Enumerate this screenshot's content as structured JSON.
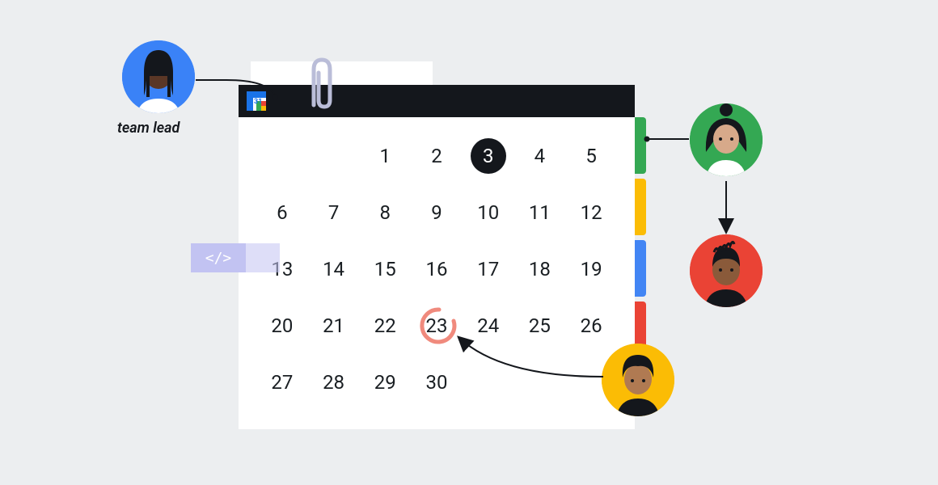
{
  "labels": {
    "team_lead": "team lead"
  },
  "calendar": {
    "icon_day": "31",
    "selected_day": 3,
    "circled_day": 23,
    "days": [
      null,
      null,
      1,
      2,
      3,
      4,
      5,
      6,
      7,
      8,
      9,
      10,
      11,
      12,
      13,
      14,
      15,
      16,
      17,
      18,
      19,
      20,
      21,
      22,
      23,
      24,
      25,
      26,
      27,
      28,
      29,
      30,
      null,
      null,
      null
    ]
  },
  "code_tag": "</>",
  "tabs": [
    "green",
    "yellow",
    "blue",
    "red"
  ],
  "avatars": {
    "team_lead": {
      "bg": "#3a82f7"
    },
    "green": {
      "bg": "#34a853"
    },
    "red": {
      "bg": "#ea4335"
    },
    "yellow": {
      "bg": "#fbbc05"
    }
  }
}
